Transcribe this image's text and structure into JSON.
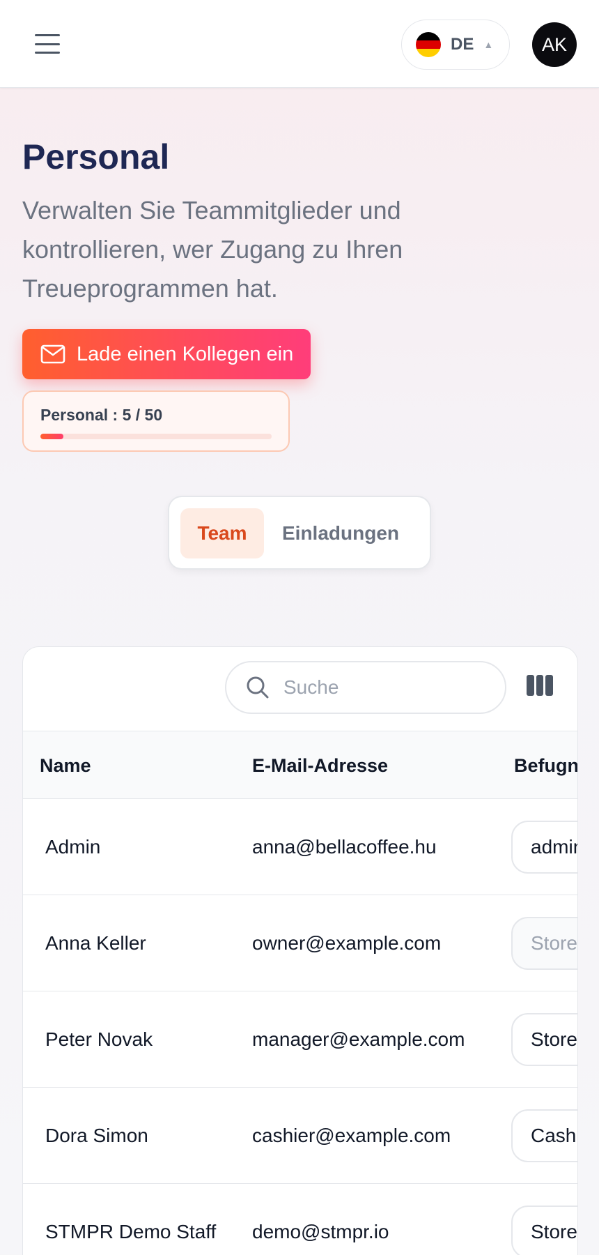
{
  "header": {
    "language": {
      "code": "DE",
      "flag_colors": [
        "#000000",
        "#dd0000",
        "#ffce00"
      ]
    },
    "avatar_initials": "AK"
  },
  "page": {
    "title": "Personal",
    "description": "Verwalten Sie Teammitglieder und kontrollieren, wer Zugang zu Ihren Treueprogrammen hat.",
    "invite_button_label": "Lade einen Kollegen ein",
    "quota": {
      "label": "Personal : 5 / 50",
      "used": 5,
      "limit": 50
    }
  },
  "tabs": [
    {
      "label": "Team",
      "active": true
    },
    {
      "label": "Einladungen",
      "active": false
    }
  ],
  "table": {
    "search_placeholder": "Suche",
    "columns": [
      "Name",
      "E-Mail-Adresse",
      "Befugnisse"
    ],
    "rows": [
      {
        "name": "Admin",
        "email": "anna@bellacoffee.hu",
        "role": "admin",
        "role_disabled": false
      },
      {
        "name": "Anna Keller",
        "email": "owner@example.com",
        "role": "Store",
        "role_disabled": true
      },
      {
        "name": "Peter Novak",
        "email": "manager@example.com",
        "role": "Store",
        "role_disabled": false
      },
      {
        "name": "Dora Simon",
        "email": "cashier@example.com",
        "role": "Cashier",
        "role_disabled": false
      },
      {
        "name": "STMPR Demo Staff",
        "email": "demo@stmpr.io",
        "role": "Store",
        "role_disabled": false
      }
    ]
  },
  "colors": {
    "accent": "#ff5f2e",
    "accent_pink": "#ff3d7a",
    "title": "#1e2753",
    "active_tab_text": "#d9481c"
  }
}
